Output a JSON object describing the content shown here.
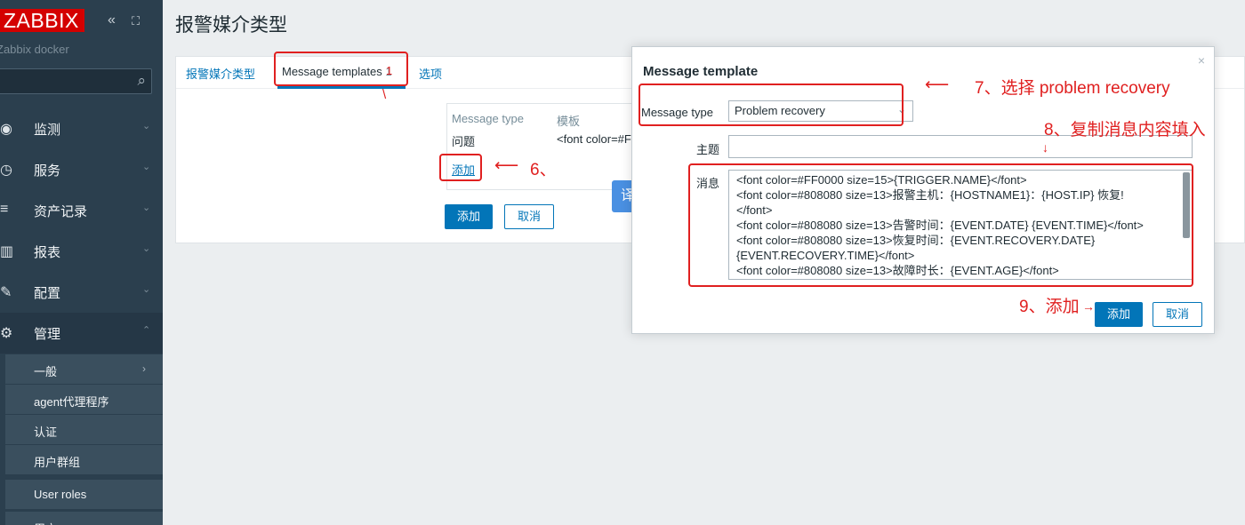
{
  "sidebar": {
    "logo": "ZABBIX",
    "collapse": "«",
    "kiosk": "⛶",
    "server_name": "Zabbix docker",
    "nav": [
      {
        "label": "监测",
        "icon": "eye-icon",
        "glyph": "◉"
      },
      {
        "label": "服务",
        "icon": "clock-icon",
        "glyph": "◷"
      },
      {
        "label": "资产记录",
        "icon": "list-icon",
        "glyph": "≡"
      },
      {
        "label": "报表",
        "icon": "chart-icon",
        "glyph": "▥"
      },
      {
        "label": "配置",
        "icon": "wrench-icon",
        "glyph": "✎"
      },
      {
        "label": "管理",
        "icon": "gear-icon",
        "glyph": "⚙"
      }
    ],
    "submenu": [
      "一般",
      "agent代理程序",
      "认证",
      "用户群组",
      "User roles",
      "用户"
    ]
  },
  "page": {
    "title": "报警媒介类型"
  },
  "tabs": [
    {
      "label": "报警媒介类型"
    },
    {
      "label": "Message templates",
      "count": "1"
    },
    {
      "label": "选项"
    }
  ],
  "templates_table": {
    "headers": [
      "Message type",
      "模板"
    ],
    "rows": [
      [
        "问题",
        "<font color=#F"
      ]
    ],
    "add_link": "添加"
  },
  "form_buttons": {
    "add": "添加",
    "cancel": "取消"
  },
  "translate_button": "译",
  "modal": {
    "title": "Message template",
    "close": "×",
    "message_type_label": "Message type",
    "message_type_value": "Problem recovery",
    "subject_label": "主题",
    "subject_value": "",
    "message_label": "消息",
    "message_lines": [
      "<font color=#FF0000 size=15>{TRIGGER.NAME}</font>",
      "<font color=#808080 size=13>报警主机：{HOSTNAME1}：{HOST.IP} 恢复!",
      "</font>",
      "<font color=#808080 size=13>告警时间：{EVENT.DATE} {EVENT.TIME}</font>",
      "<font color=#808080 size=13>恢复时间：{EVENT.RECOVERY.DATE}",
      "{EVENT.RECOVERY.TIME}</font>",
      "<font color=#808080 size=13>故障时长：{EVENT.AGE}</font>"
    ],
    "add_button": "添加",
    "cancel_button": "取消"
  },
  "annotations": {
    "step1": "1",
    "step6": "6、",
    "step7": "7、选择 problem recovery",
    "step8": "8、复制消息内容填入",
    "step9": "9、添加"
  },
  "colors": {
    "sidebar_bg": "#2b3f4e",
    "accent": "#0275b8",
    "annotation_red": "#e02020",
    "logo_red": "#d40000"
  }
}
